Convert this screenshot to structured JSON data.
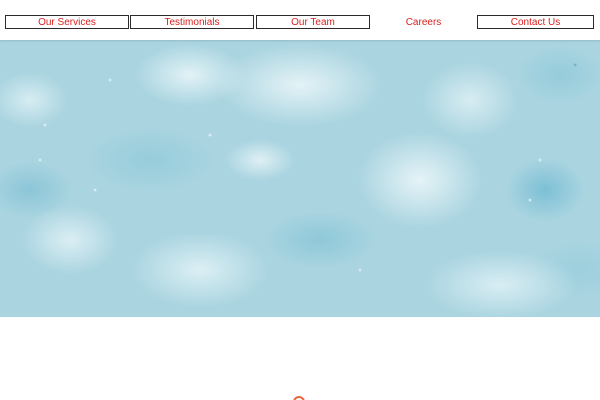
{
  "nav": {
    "items": [
      {
        "label": "Our Services"
      },
      {
        "label": "Testimonials"
      },
      {
        "label": "Our Team"
      },
      {
        "label": "Careers"
      },
      {
        "label": "Contact Us"
      }
    ]
  },
  "colors": {
    "nav_text": "#d9201f",
    "nav_border": "#2b2b2b",
    "hero_base": "#a9d4e0",
    "accent": "#e8643a"
  }
}
